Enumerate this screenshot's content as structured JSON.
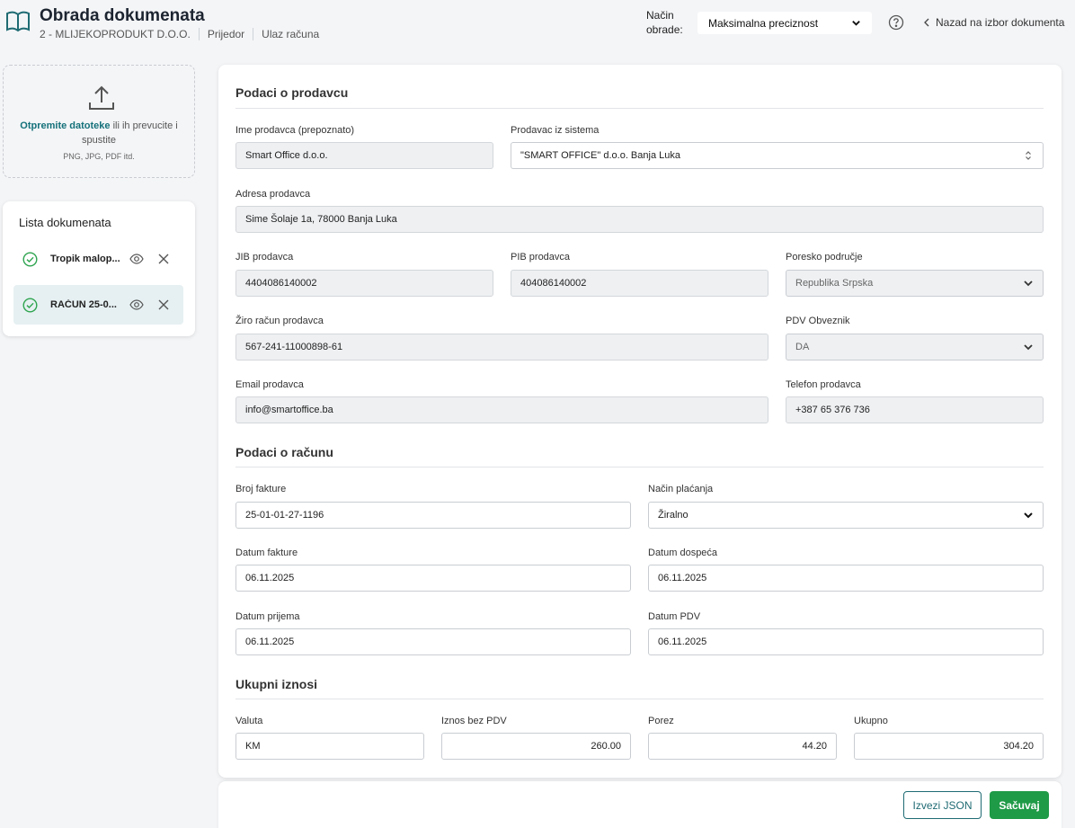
{
  "header": {
    "title": "Obrada dokumenata",
    "company": "2 - MLIJEKOPRODUKT D.O.O.",
    "city": "Prijedor",
    "doc_type": "Ulaz računa",
    "mode_label": "Način obrade:",
    "mode_value": "Maksimalna preciznost",
    "back_label": "Nazad na izbor dokumenta"
  },
  "upload": {
    "link_text": "Otpremite datoteke",
    "rest_text": " ili ih prevucite i spustite",
    "hint": "PNG, JPG, PDF itd."
  },
  "doclist": {
    "title": "Lista dokumenata",
    "items": [
      {
        "name": "Tropik malop...",
        "active": false
      },
      {
        "name": "RAČUN 25-0...",
        "active": true
      }
    ]
  },
  "seller": {
    "section_title": "Podaci o prodavcu",
    "name_label": "Ime prodavca (prepoznato)",
    "name_value": "Smart Office d.o.o.",
    "system_label": "Prodavac iz sistema",
    "system_value": "\"SMART OFFICE\" d.o.o. Banja Luka",
    "address_label": "Adresa prodavca",
    "address_value": "Sime Šolaje 1a, 78000 Banja Luka",
    "jib_label": "JIB prodavca",
    "jib_value": "4404086140002",
    "pib_label": "PIB prodavca",
    "pib_value": "404086140002",
    "tax_area_label": "Poresko područje",
    "tax_area_value": "Republika Srpska",
    "account_label": "Žiro račun prodavca",
    "account_value": "567-241-11000898-61",
    "vat_label": "PDV Obveznik",
    "vat_value": "DA",
    "email_label": "Email prodavca",
    "email_value": "info@smartoffice.ba",
    "phone_label": "Telefon prodavca",
    "phone_value": "+387 65 376 736"
  },
  "invoice": {
    "section_title": "Podaci o računu",
    "number_label": "Broj fakture",
    "number_value": "25-01-01-27-1196",
    "payment_label": "Način plaćanja",
    "payment_value": "Žiralno",
    "date_label": "Datum fakture",
    "date_value": "06.11.2025",
    "due_label": "Datum dospeća",
    "due_value": "06.11.2025",
    "received_label": "Datum prijema",
    "received_value": "06.11.2025",
    "vat_date_label": "Datum PDV",
    "vat_date_value": "06.11.2025"
  },
  "totals": {
    "section_title": "Ukupni iznosi",
    "currency_label": "Valuta",
    "currency_value": "KM",
    "net_label": "Iznos bez PDV",
    "net_value": "260.00",
    "tax_label": "Porez",
    "tax_value": "44.20",
    "total_label": "Ukupno",
    "total_value": "304.20"
  },
  "footer": {
    "export_label": "Izvezi JSON",
    "save_label": "Sačuvaj"
  },
  "colors": {
    "accent": "#14717a",
    "save_green": "#1f9a47",
    "check_green": "#2ea44f"
  }
}
